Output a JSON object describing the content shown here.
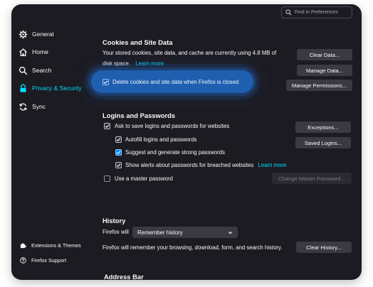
{
  "search": {
    "placeholder": "Find in Preferences"
  },
  "sidebar": {
    "items": [
      {
        "label": "General",
        "icon": "gear-icon",
        "active": false
      },
      {
        "label": "Home",
        "icon": "home-icon",
        "active": false
      },
      {
        "label": "Search",
        "icon": "search-icon",
        "active": false
      },
      {
        "label": "Privacy & Security",
        "icon": "lock-icon",
        "active": true
      },
      {
        "label": "Sync",
        "icon": "sync-icon",
        "active": false
      }
    ],
    "footer": [
      {
        "label": "Extensions & Themes",
        "icon": "puzzle-icon"
      },
      {
        "label": "Firefox Support",
        "icon": "help-icon"
      }
    ]
  },
  "cookies": {
    "title": "Cookies and Site Data",
    "desc_line1": "Your stored cookies, site data, and cache are currently using 4.8 MB of",
    "desc_line2": "disk space.",
    "learn_more": "Learn more",
    "clear_data": "Clear Data...",
    "manage_data": "Manage Data...",
    "manage_permissions": "Manage Permissions...",
    "delete_on_close": {
      "label": "Delete cookies and site data when Firefox is closed",
      "checked": true
    }
  },
  "logins": {
    "title": "Logins and Passwords",
    "ask_save": {
      "label": "Ask to save logins and passwords for websites",
      "checked": true
    },
    "autofill": {
      "label": "Autofill logins and passwords",
      "checked": true
    },
    "suggest": {
      "label": "Suggest and generate strong passwords",
      "checked": true
    },
    "alerts": {
      "label": "Show alerts about passwords for breached websites",
      "checked": true
    },
    "alerts_learn_more": "Learn more",
    "master": {
      "label": "Use a master password",
      "checked": false
    },
    "exceptions": "Exceptions...",
    "saved_logins": "Saved Logins...",
    "change_master": "Change Master Password..."
  },
  "history": {
    "title": "History",
    "firefox_will": "Firefox will",
    "mode": "Remember history",
    "desc": "Firefox will remember your browsing, download, form, and search history.",
    "clear_history": "Clear History..."
  },
  "address_bar": {
    "title": "Address Bar"
  },
  "colors": {
    "background": "#1c1b22",
    "accent": "#00ddff",
    "button": "#3a3944",
    "checkbox_accent": "#0a84ff"
  }
}
